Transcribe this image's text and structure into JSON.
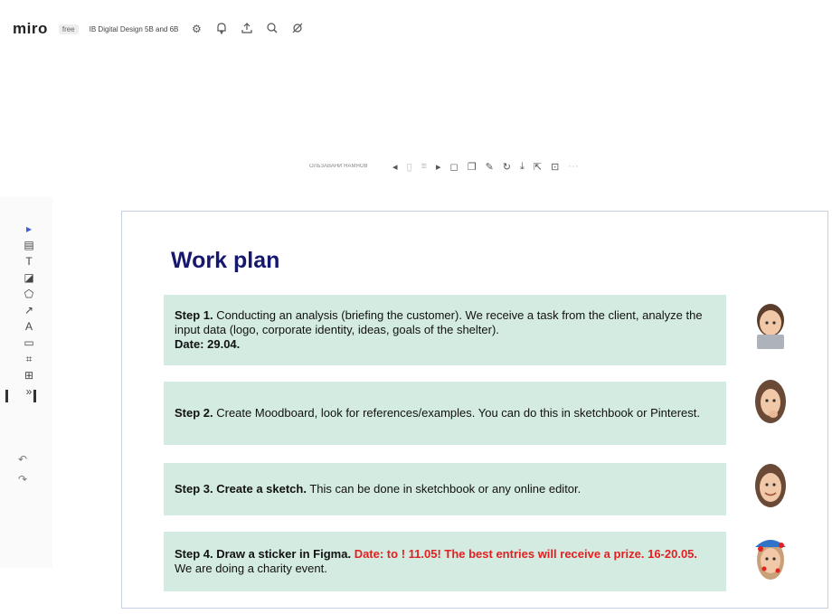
{
  "app": {
    "logo": "miro",
    "plan_badge": "free",
    "board_title": "IB Digital Design 5B and 6B"
  },
  "top_icons": [
    "settings-icon",
    "bell-icon",
    "share-upload-icon",
    "search-icon",
    "collaboration-icon"
  ],
  "frame_toolbar": {
    "frame_name": "ОЛЬЗАВАНИ НАМЯОВ"
  },
  "board": {
    "title": "Work plan",
    "steps": [
      {
        "label": "Step 1.",
        "text": " Conducting an analysis (briefing the customer). We receive a task from the client, analyze the input data (logo, corporate identity, ideas, goals of the shelter).",
        "date": "Date: 29.04."
      },
      {
        "label": "Step 2.",
        "text": " Create Moodboard, look for references/examples. You can do this in sketchbook or Pinterest."
      },
      {
        "label": "Step 3. Create a sketch.",
        "text": " This can be done in sketchbook or any online editor."
      },
      {
        "label": "Step 4. Draw a sticker in Figma.",
        "highlight": " Date: to ! 11.05! The best entries will receive a prize. 16-20.05.",
        "text": " We are doing a charity event."
      }
    ]
  },
  "colors": {
    "title": "#16176e",
    "step_background": "#d4ebe1",
    "highlight": "#e22020",
    "frame_border": "#c6d0e4"
  }
}
